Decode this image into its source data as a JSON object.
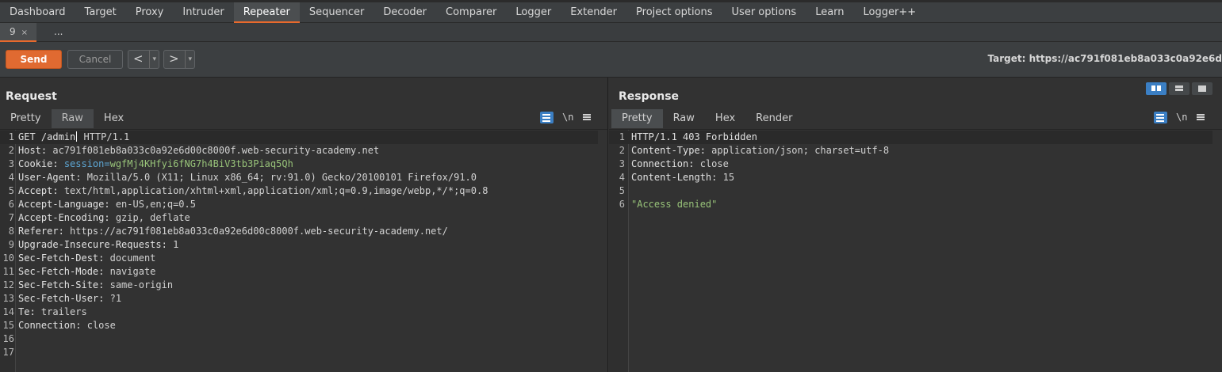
{
  "main_tabs": [
    "Dashboard",
    "Target",
    "Proxy",
    "Intruder",
    "Repeater",
    "Sequencer",
    "Decoder",
    "Comparer",
    "Logger",
    "Extender",
    "Project options",
    "User options",
    "Learn",
    "Logger++"
  ],
  "active_main_tab": "Repeater",
  "repeater_tabs": {
    "active": "9",
    "close": "×",
    "more": "..."
  },
  "toolbar": {
    "send": "Send",
    "cancel": "Cancel",
    "back": "<",
    "forward": ">",
    "dropdown": "▾",
    "target": "Target: https://ac791f081eb8a033c0a92e6d"
  },
  "request": {
    "title": "Request",
    "tabs": [
      "Pretty",
      "Raw",
      "Hex"
    ],
    "active_tab": "Raw",
    "newline_toggle": "\\n",
    "lines": [
      {
        "n": "1",
        "name": "GET /admin",
        "sep": "",
        "value": " HTTP/1.1",
        "caret": true
      },
      {
        "n": "2",
        "name": "Host:",
        "sep": " ",
        "value": "ac791f081eb8a033c0a92e6d00c8000f.web-security-academy.net"
      },
      {
        "n": "3",
        "name": "Cookie:",
        "sep": " ",
        "cookie_name": "session=",
        "value": "wgfMj4KHfyi6fNG7h4BiV3tb3Piaq5Qh",
        "cookie": true
      },
      {
        "n": "4",
        "name": "User-Agent:",
        "sep": " ",
        "value": "Mozilla/5.0 (X11; Linux x86_64; rv:91.0) Gecko/20100101 Firefox/91.0"
      },
      {
        "n": "5",
        "name": "Accept:",
        "sep": " ",
        "value": "text/html,application/xhtml+xml,application/xml;q=0.9,image/webp,*/*;q=0.8"
      },
      {
        "n": "6",
        "name": "Accept-Language:",
        "sep": " ",
        "value": "en-US,en;q=0.5"
      },
      {
        "n": "7",
        "name": "Accept-Encoding:",
        "sep": " ",
        "value": "gzip, deflate"
      },
      {
        "n": "8",
        "name": "Referer:",
        "sep": " ",
        "value": "https://ac791f081eb8a033c0a92e6d00c8000f.web-security-academy.net/"
      },
      {
        "n": "9",
        "name": "Upgrade-Insecure-Requests:",
        "sep": " ",
        "value": "1"
      },
      {
        "n": "10",
        "name": "Sec-Fetch-Dest:",
        "sep": " ",
        "value": "document"
      },
      {
        "n": "11",
        "name": "Sec-Fetch-Mode:",
        "sep": " ",
        "value": "navigate"
      },
      {
        "n": "12",
        "name": "Sec-Fetch-Site:",
        "sep": " ",
        "value": "same-origin"
      },
      {
        "n": "13",
        "name": "Sec-Fetch-User:",
        "sep": " ",
        "value": "?1"
      },
      {
        "n": "14",
        "name": "Te:",
        "sep": " ",
        "value": "trailers"
      },
      {
        "n": "15",
        "name": "Connection:",
        "sep": " ",
        "value": "close"
      },
      {
        "n": "16",
        "name": "",
        "sep": "",
        "value": ""
      },
      {
        "n": "17",
        "name": "",
        "sep": "",
        "value": ""
      }
    ]
  },
  "response": {
    "title": "Response",
    "tabs": [
      "Pretty",
      "Raw",
      "Hex",
      "Render"
    ],
    "active_tab": "Pretty",
    "newline_toggle": "\\n",
    "lines": [
      {
        "n": "1",
        "name": "HTTP/1.1 403 Forbidden",
        "sep": "",
        "value": ""
      },
      {
        "n": "2",
        "name": "Content-Type:",
        "sep": " ",
        "value": "application/json; charset=utf-8"
      },
      {
        "n": "3",
        "name": "Connection:",
        "sep": " ",
        "value": "close"
      },
      {
        "n": "4",
        "name": "Content-Length:",
        "sep": " ",
        "value": "15"
      },
      {
        "n": "5",
        "name": "",
        "sep": "",
        "value": ""
      },
      {
        "n": "6",
        "name": "",
        "sep": "",
        "value": "\"Access denied\"",
        "green": true
      }
    ]
  },
  "colors": {
    "accent": "#e06a31",
    "selected_blue": "#3b7fc4",
    "string_green": "#98c379",
    "cookie_blue": "#5ea8d6"
  }
}
